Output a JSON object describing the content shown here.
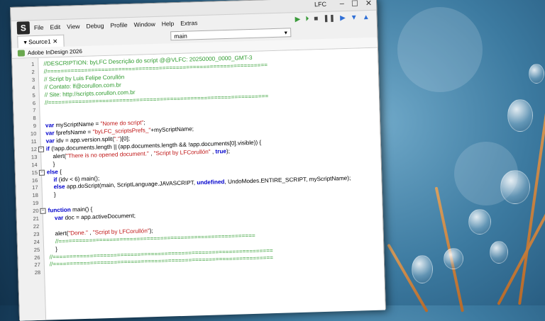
{
  "window": {
    "app_label": "LFC",
    "menu": [
      "File",
      "Edit",
      "View",
      "Debug",
      "Profile",
      "Window",
      "Help",
      "Extras"
    ],
    "tab": "Source1",
    "function_selector": "main",
    "target_app": "Adobe InDesign 2026",
    "minimize": "–",
    "maximize": "☐",
    "close": "✕"
  },
  "toolbar_icons": [
    "play-icon",
    "step-icon",
    "stop-icon",
    "pause-icon",
    "step-over-icon",
    "step-into-icon",
    "step-out-icon"
  ],
  "lines": [
    {
      "n": "1",
      "code": "//DESCRIPTION: byLFC Descrição do script @@VLFC: 20250000_0000_GMT-3",
      "type": "comment"
    },
    {
      "n": "2",
      "code": "//=================================================================",
      "type": "comment"
    },
    {
      "n": "3",
      "code": "// Script by Luis Felipe Corullón",
      "type": "comment"
    },
    {
      "n": "4",
      "code": "// Contato: lf@corullon.com.br",
      "type": "comment"
    },
    {
      "n": "5",
      "code": "// Site: http://scripts.corullon.com.br",
      "type": "comment"
    },
    {
      "n": "6",
      "code": "//=================================================================",
      "type": "comment"
    },
    {
      "n": "7",
      "code": "",
      "type": "text"
    },
    {
      "n": "8",
      "code": "",
      "type": "text"
    },
    {
      "n": "9",
      "code": "var myScriptName = \"Nome do script\";",
      "type": "mixed"
    },
    {
      "n": "10",
      "code": "var fprefsName = \"byLFC_scriptsPrefs_\"+myScriptName;",
      "type": "mixed"
    },
    {
      "n": "11",
      "code": "var idv = app.version.split(\".\")[0];",
      "type": "mixed"
    },
    {
      "n": "12",
      "code": "if (!app.documents.length || (app.documents.length && !app.documents[0].visible)) {",
      "type": "mixed"
    },
    {
      "n": "13",
      "code": "    alert(\"There is no opened document.\" , \"Script by LFCorullón\" , true);",
      "type": "mixed"
    },
    {
      "n": "14",
      "code": "    }",
      "type": "text"
    },
    {
      "n": "15",
      "code": "else {",
      "type": "mixed"
    },
    {
      "n": "16",
      "code": "    if (idv < 6) main();",
      "type": "mixed"
    },
    {
      "n": "17",
      "code": "    else app.doScript(main, ScriptLanguage.JAVASCRIPT, undefined, UndoModes.ENTIRE_SCRIPT, myScriptName);",
      "type": "mixed"
    },
    {
      "n": "18",
      "code": "    }",
      "type": "text"
    },
    {
      "n": "19",
      "code": "",
      "type": "text"
    },
    {
      "n": "20",
      "code": "function main() {",
      "type": "mixed"
    },
    {
      "n": "21",
      "code": "    var doc = app.activeDocument;",
      "type": "mixed"
    },
    {
      "n": "22",
      "code": "",
      "type": "text"
    },
    {
      "n": "23",
      "code": "    alert(\"Done.\" , \"Script by LFCorullón\");",
      "type": "mixed"
    },
    {
      "n": "24",
      "code": "    //==========================================================",
      "type": "comment"
    },
    {
      "n": "25",
      "code": "    }",
      "type": "text"
    },
    {
      "n": "26",
      "code": "//=================================================================",
      "type": "comment"
    },
    {
      "n": "27",
      "code": "//=================================================================",
      "type": "comment"
    },
    {
      "n": "28",
      "code": "",
      "type": "text"
    }
  ]
}
